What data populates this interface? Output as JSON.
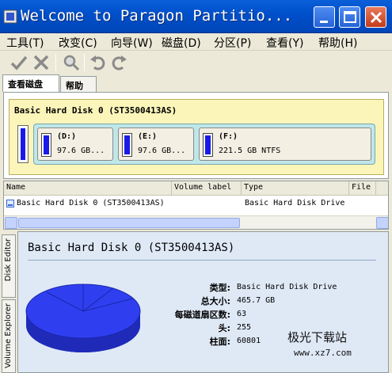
{
  "window": {
    "title": "Welcome to Paragon Partitio...",
    "minimize_icon": "minimize-icon",
    "maximize_icon": "maximize-icon",
    "close_icon": "close-icon"
  },
  "menu": [
    {
      "label": "工具(T)"
    },
    {
      "label": "改变(C)"
    },
    {
      "label": "向导(W)"
    },
    {
      "label": "磁盘(D)"
    },
    {
      "label": "分区(P)"
    },
    {
      "label": "查看(Y)"
    },
    {
      "label": "帮助(H)"
    }
  ],
  "toolbar": {
    "icons": [
      "apply-checkmark-icon",
      "discard-x-icon",
      "magnifier-icon",
      "undo-icon",
      "redo-icon"
    ]
  },
  "tabs": [
    {
      "label": "查看磁盘",
      "active": true
    },
    {
      "label": "帮助",
      "active": false
    }
  ],
  "disk_map": {
    "disk_label": "Basic Hard Disk 0 (ST3500413AS)",
    "partitions": [
      {
        "name": "(D:)",
        "size": "97.6 GB..."
      },
      {
        "name": "(E:)",
        "size": "97.6 GB..."
      },
      {
        "name": "(F:)",
        "size": "221.5 GB NTFS"
      }
    ]
  },
  "list": {
    "columns": [
      "Name",
      "Volume label",
      "Type",
      "File"
    ],
    "rows": [
      {
        "name": "Basic Hard Disk 0 (ST3500413AS)",
        "volume_label": "",
        "type": "Basic Hard Disk Drive",
        "file": ""
      }
    ]
  },
  "side_tabs": [
    "Disk Editor",
    "Volume Explorer"
  ],
  "details": {
    "title": "Basic Hard Disk 0 (ST3500413AS)",
    "properties": [
      {
        "key": "类型:",
        "value": "Basic Hard Disk Drive"
      },
      {
        "key": "总大小:",
        "value": "465.7 GB"
      },
      {
        "key": "每磁道扇区数:",
        "value": "63"
      },
      {
        "key": "头:",
        "value": "255"
      },
      {
        "key": "柱面:",
        "value": "60801"
      }
    ]
  },
  "watermark": {
    "text": "极光下载站",
    "url": "www.xz7.com"
  },
  "colors": {
    "titlebar": "#0050cc",
    "partition_fill": "#1a1ae6",
    "disk_frame": "#fbf5ba",
    "partition_strip": "#bfe7e9",
    "pie": "#2233ee",
    "details_bg": "#dfe9f6"
  }
}
